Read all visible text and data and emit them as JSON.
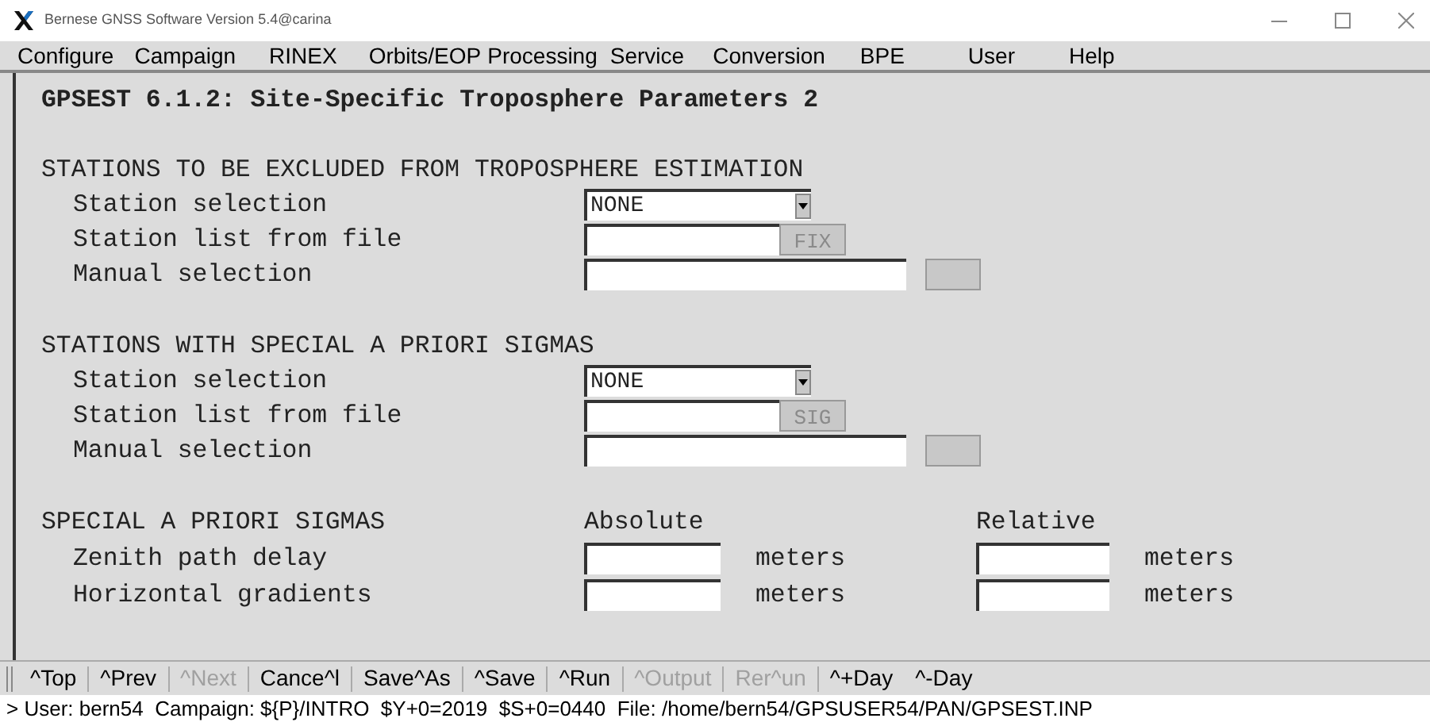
{
  "window": {
    "title": "Bernese GNSS Software Version 5.4@carina"
  },
  "menu": [
    "Configure",
    "Campaign",
    "RINEX",
    "Orbits/EOP",
    "Processing",
    "Service",
    "Conversion",
    "BPE",
    "User",
    "Help"
  ],
  "panel_title": "GPSEST 6.1.2: Site-Specific Troposphere Parameters 2",
  "sections": [
    {
      "heading": "STATIONS TO BE EXCLUDED FROM TROPOSPHERE ESTIMATION",
      "rows": [
        {
          "kind": "select",
          "label": "Station selection",
          "value": "NONE"
        },
        {
          "kind": "file",
          "label": "Station list from file",
          "button": "FIX",
          "disabled": true
        },
        {
          "kind": "manual",
          "label": "Manual selection"
        }
      ]
    },
    {
      "heading": "STATIONS WITH SPECIAL A PRIORI SIGMAS",
      "rows": [
        {
          "kind": "select",
          "label": "Station selection",
          "value": "NONE"
        },
        {
          "kind": "file",
          "label": "Station list from file",
          "button": "SIG",
          "disabled": true
        },
        {
          "kind": "manual",
          "label": "Manual selection"
        }
      ]
    }
  ],
  "sigmas": {
    "heading": "SPECIAL A PRIORI SIGMAS",
    "columns": [
      "Absolute",
      "Relative"
    ],
    "rows": [
      {
        "label": "Zenith path delay",
        "units": [
          "meters",
          "meters"
        ]
      },
      {
        "label": "Horizontal gradients",
        "units": [
          "meters",
          "meters"
        ]
      }
    ]
  },
  "toolbar": [
    {
      "label": "^Top",
      "disabled": false
    },
    {
      "label": "^Prev",
      "disabled": false
    },
    {
      "label": "^Next",
      "disabled": true
    },
    {
      "label": "Cance^l",
      "disabled": false
    },
    {
      "label": "Save^As",
      "disabled": false
    },
    {
      "label": "^Save",
      "disabled": false
    },
    {
      "label": "^Run",
      "disabled": false
    },
    {
      "label": "^Output",
      "disabled": true
    },
    {
      "label": "Rer^un",
      "disabled": true
    },
    {
      "label": "^+Day",
      "disabled": false
    },
    {
      "label": "^-Day",
      "disabled": false
    }
  ],
  "status_bar": "> User: bern54  Campaign: ${P}/INTRO  $Y+0=2019  $S+0=0440  File: /home/bern54/GPSUSER54/PAN/GPSEST.INP"
}
